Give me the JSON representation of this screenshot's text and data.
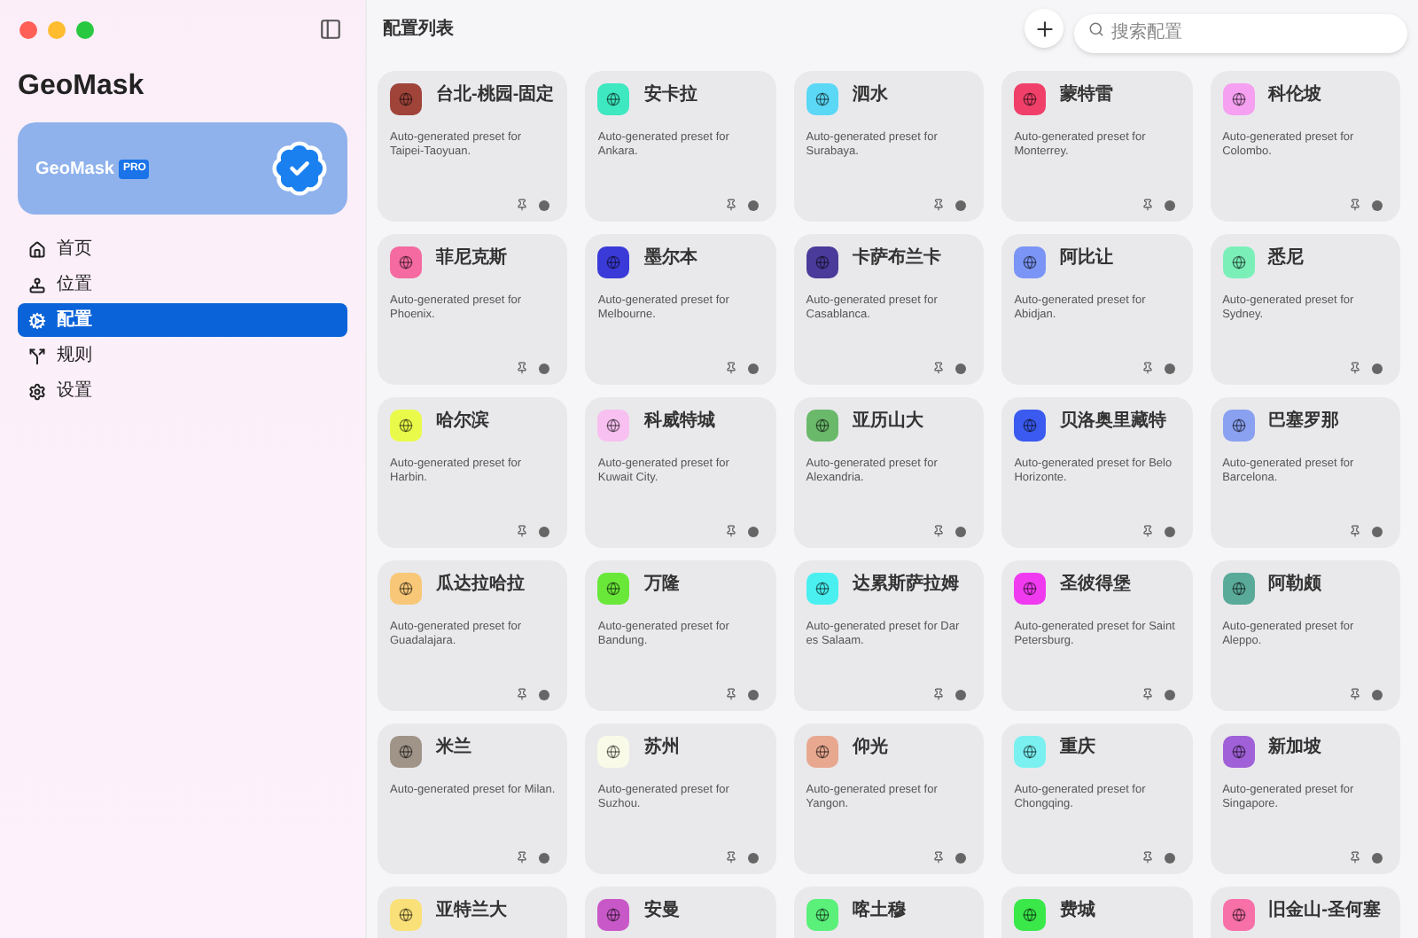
{
  "app": {
    "title": "GeoMask"
  },
  "pro_card": {
    "name": "GeoMask",
    "badge": "PRO"
  },
  "nav": [
    {
      "label": "首页",
      "selected": false
    },
    {
      "label": "位置",
      "selected": false
    },
    {
      "label": "配置",
      "selected": true
    },
    {
      "label": "规则",
      "selected": false
    },
    {
      "label": "设置",
      "selected": false
    }
  ],
  "header": {
    "title": "配置列表",
    "search": {
      "placeholder": "搜索配置"
    }
  },
  "presets": [
    {
      "name": "台北-桃园-固定",
      "color": "#a0443a",
      "description": "Auto-generated preset for Taipei-Taoyuan."
    },
    {
      "name": "安卡拉",
      "color": "#3ee8c0",
      "description": "Auto-generated preset for Ankara."
    },
    {
      "name": "泗水",
      "color": "#5ad8f5",
      "description": "Auto-generated preset for Surabaya."
    },
    {
      "name": "蒙特雷",
      "color": "#f0406a",
      "description": "Auto-generated preset for Monterrey."
    },
    {
      "name": "科伦坡",
      "color": "#f5a0f0",
      "description": "Auto-generated preset for Colombo."
    },
    {
      "name": "菲尼克斯",
      "color": "#f56aa0",
      "description": "Auto-generated preset for Phoenix."
    },
    {
      "name": "墨尔本",
      "color": "#3a3ad8",
      "description": "Auto-generated preset for Melbourne."
    },
    {
      "name": "卡萨布兰卡",
      "color": "#4a3a9a",
      "description": "Auto-generated preset for Casablanca."
    },
    {
      "name": "阿比让",
      "color": "#7a95f5",
      "description": "Auto-generated preset for Abidjan."
    },
    {
      "name": "悉尼",
      "color": "#7af0b8",
      "description": "Auto-generated preset for Sydney."
    },
    {
      "name": "哈尔滨",
      "color": "#eafa4a",
      "description": "Auto-generated preset for Harbin."
    },
    {
      "name": "科威特城",
      "color": "#f8c0f0",
      "description": "Auto-generated preset for Kuwait City."
    },
    {
      "name": "亚历山大",
      "color": "#6ab86a",
      "description": "Auto-generated preset for Alexandria."
    },
    {
      "name": "贝洛奥里藏特",
      "color": "#3a5af0",
      "description": "Auto-generated preset for Belo Horizonte."
    },
    {
      "name": "巴塞罗那",
      "color": "#8aa0f0",
      "description": "Auto-generated preset for Barcelona."
    },
    {
      "name": "瓜达拉哈拉",
      "color": "#f8c878",
      "description": "Auto-generated preset for Guadalajara."
    },
    {
      "name": "万隆",
      "color": "#6ae83a",
      "description": "Auto-generated preset for Bandung."
    },
    {
      "name": "达累斯萨拉姆",
      "color": "#4af0f0",
      "description": "Auto-generated preset for Dar es Salaam."
    },
    {
      "name": "圣彼得堡",
      "color": "#f03af0",
      "description": "Auto-generated preset for Saint Petersburg."
    },
    {
      "name": "阿勒颇",
      "color": "#5aaa9a",
      "description": "Auto-generated preset for Aleppo."
    },
    {
      "name": "米兰",
      "color": "#a09488",
      "description": "Auto-generated preset for Milan."
    },
    {
      "name": "苏州",
      "color": "#fafae8",
      "description": "Auto-generated preset for Suzhou."
    },
    {
      "name": "仰光",
      "color": "#e8a890",
      "description": "Auto-generated preset for Yangon."
    },
    {
      "name": "重庆",
      "color": "#7af0f0",
      "description": "Auto-generated preset for Chongqing."
    },
    {
      "name": "新加坡",
      "color": "#a060d8",
      "description": "Auto-generated preset for Singapore."
    },
    {
      "name": "亚特兰大",
      "color": "#fae078"
    },
    {
      "name": "安曼",
      "color": "#c858c8"
    },
    {
      "name": "喀土穆",
      "color": "#5af07a"
    },
    {
      "name": "费城",
      "color": "#3ae84a"
    },
    {
      "name": "旧金山-圣何塞",
      "color": "#f870a8"
    }
  ]
}
